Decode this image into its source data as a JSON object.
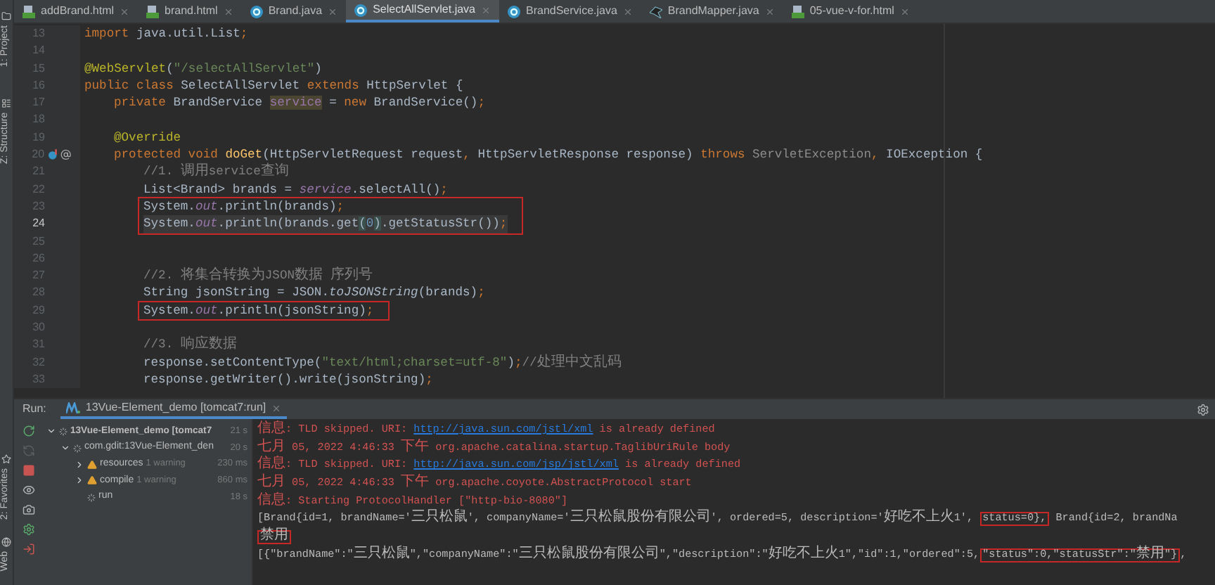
{
  "tool_strip": {
    "top": [
      {
        "label": "1: Project",
        "kind": "project"
      },
      {
        "label": "Z: Structure",
        "kind": "structure"
      }
    ],
    "bottom": [
      {
        "label": "2: Favorites",
        "kind": "favorites"
      },
      {
        "label": "Web",
        "kind": "web"
      }
    ]
  },
  "tabs": [
    {
      "label": "addBrand.html",
      "kind": "html",
      "selected": false
    },
    {
      "label": "brand.html",
      "kind": "html",
      "selected": false
    },
    {
      "label": "Brand.java",
      "kind": "class",
      "selected": false
    },
    {
      "label": "SelectAllServlet.java",
      "kind": "class",
      "selected": true
    },
    {
      "label": "BrandService.java",
      "kind": "class",
      "selected": false
    },
    {
      "label": "BrandMapper.java",
      "kind": "mapper",
      "selected": false
    },
    {
      "label": "05-vue-v-for.html",
      "kind": "html",
      "selected": false
    }
  ],
  "editor": {
    "lines": [
      {
        "kind": "line",
        "number": "13",
        "current": false,
        "tokens": [
          {
            "kind": "kw",
            "t": "import"
          },
          {
            "kind": "plain",
            "t": " java.util.List"
          },
          {
            "kind": "kw",
            "t": ";"
          }
        ]
      },
      {
        "kind": "line",
        "number": "14",
        "current": false
      },
      {
        "kind": "line",
        "number": "15",
        "current": false,
        "tokens": [
          {
            "kind": "ann",
            "t": "@WebServlet"
          },
          {
            "kind": "plain",
            "t": "("
          },
          {
            "kind": "str",
            "t": "\"/selectAllServlet\""
          },
          {
            "kind": "plain",
            "t": ")"
          }
        ]
      },
      {
        "kind": "line",
        "number": "16",
        "current": false,
        "tokens": [
          {
            "kind": "kw",
            "t": "public class"
          },
          {
            "kind": "plain",
            "t": " SelectAllServlet "
          },
          {
            "kind": "kw",
            "t": "extends"
          },
          {
            "kind": "plain",
            "t": " HttpServlet {"
          }
        ],
        "children": [
          {
            "kind": "line",
            "number": "17",
            "current": false,
            "tokens": [
              {
                "kind": "kw",
                "t": "private"
              },
              {
                "kind": "plain",
                "t": " BrandService "
              },
              {
                "kind": "usage",
                "t": "service"
              },
              {
                "kind": "plain",
                "t": " = "
              },
              {
                "kind": "kw",
                "t": "new"
              },
              {
                "kind": "plain",
                "t": " BrandService()"
              },
              {
                "kind": "kw",
                "t": ";"
              }
            ]
          },
          {
            "kind": "line",
            "number": "18",
            "current": false
          },
          {
            "kind": "line",
            "number": "19",
            "current": false,
            "tokens": [
              {
                "kind": "ann",
                "t": "@Override"
              }
            ]
          },
          {
            "kind": "line",
            "number": "20",
            "current": false,
            "gutter_icons": [
              {
                "kind": "overrides"
              },
              {
                "kind": "annotated"
              }
            ],
            "tokens": [
              {
                "kind": "kw",
                "t": "protected void "
              },
              {
                "kind": "fn",
                "t": "doGet"
              },
              {
                "kind": "plain",
                "t": "(HttpServletRequest request"
              },
              {
                "kind": "kw",
                "t": ","
              },
              {
                "kind": "plain",
                "t": " HttpServletResponse response) "
              },
              {
                "kind": "kw",
                "t": "throws "
              },
              {
                "kind": "muted",
                "t": "ServletException"
              },
              {
                "kind": "kw",
                "t": ","
              },
              {
                "kind": "plain",
                "t": " IOException {"
              }
            ],
            "children": [
              {
                "kind": "line",
                "number": "21",
                "current": false,
                "tokens": [
                  {
                    "kind": "cmt",
                    "t": "//1. 调用service查询"
                  }
                ]
              },
              {
                "kind": "line",
                "number": "22",
                "current": false,
                "tokens": [
                  {
                    "kind": "plain",
                    "t": "List<Brand> brands = "
                  },
                  {
                    "kind": "field",
                    "t": "service"
                  },
                  {
                    "kind": "plain",
                    "t": ".selectAll()"
                  },
                  {
                    "kind": "kw",
                    "t": ";"
                  }
                ]
              },
              {
                "kind": "box",
                "lines": [
                  {
                    "kind": "line",
                    "number": "23",
                    "current": false,
                    "tokens": [
                      {
                        "kind": "plain",
                        "t": "System."
                      },
                      {
                        "kind": "field",
                        "t": "out"
                      },
                      {
                        "kind": "plain",
                        "t": ".println(brands)"
                      },
                      {
                        "kind": "kw",
                        "t": ";"
                      }
                    ]
                  },
                  {
                    "kind": "line",
                    "number": "24",
                    "current": true,
                    "tokens": [
                      {
                        "kind": "plain",
                        "t": "System."
                      },
                      {
                        "kind": "field",
                        "t": "out"
                      },
                      {
                        "kind": "plain",
                        "t": ".println(brands.get"
                      },
                      {
                        "kind": "match",
                        "t": "("
                      },
                      {
                        "kind": "num",
                        "t": "0"
                      },
                      {
                        "kind": "match",
                        "t": ")"
                      },
                      {
                        "kind": "plain",
                        "t": ".getStatusStr())"
                      },
                      {
                        "kind": "kw",
                        "t": ";"
                      }
                    ]
                  }
                ]
              },
              {
                "kind": "line",
                "number": "25",
                "current": false
              },
              {
                "kind": "line",
                "number": "26",
                "current": false
              },
              {
                "kind": "line",
                "number": "27",
                "current": false,
                "tokens": [
                  {
                    "kind": "cmt",
                    "t": "//2. 将集合转换为JSON数据 序列号"
                  }
                ]
              },
              {
                "kind": "line",
                "number": "28",
                "current": false,
                "tokens": [
                  {
                    "kind": "plain",
                    "t": "String jsonString = JSON."
                  },
                  {
                    "kind": "static",
                    "t": "toJSONString"
                  },
                  {
                    "kind": "plain",
                    "t": "(brands)"
                  },
                  {
                    "kind": "kw",
                    "t": ";"
                  }
                ]
              },
              {
                "kind": "box",
                "lines": [
                  {
                    "kind": "line",
                    "number": "29",
                    "current": false,
                    "tokens": [
                      {
                        "kind": "plain",
                        "t": "System."
                      },
                      {
                        "kind": "field",
                        "t": "out"
                      },
                      {
                        "kind": "plain",
                        "t": ".println(jsonString)"
                      },
                      {
                        "kind": "kw",
                        "t": ";"
                      }
                    ]
                  }
                ]
              },
              {
                "kind": "line",
                "number": "30",
                "current": false
              },
              {
                "kind": "line",
                "number": "31",
                "current": false,
                "tokens": [
                  {
                    "kind": "cmt",
                    "t": "//3. 响应数据"
                  }
                ]
              },
              {
                "kind": "line",
                "number": "32",
                "current": false,
                "tokens": [
                  {
                    "kind": "plain",
                    "t": "response.setContentType("
                  },
                  {
                    "kind": "str",
                    "t": "\"text/html;charset=utf-8\""
                  },
                  {
                    "kind": "plain",
                    "t": ")"
                  },
                  {
                    "kind": "kw",
                    "t": ";"
                  },
                  {
                    "kind": "cmt",
                    "t": "//处理中文乱码"
                  }
                ]
              },
              {
                "kind": "line",
                "number": "33",
                "current": false,
                "tokens": [
                  {
                    "kind": "plain",
                    "t": "response.getWriter().write(jsonString)"
                  },
                  {
                    "kind": "kw",
                    "t": ";"
                  }
                ]
              }
            ]
          }
        ]
      }
    ]
  },
  "run": {
    "label": "Run:",
    "tab": "13Vue-Element_demo [tomcat7:run]",
    "toolbar": [
      {
        "kind": "rerun",
        "disabled": false
      },
      {
        "kind": "rerun_failed",
        "disabled": true
      },
      {
        "kind": "stop",
        "disabled": false
      },
      {
        "kind": "view",
        "disabled": false
      },
      {
        "kind": "snapshot",
        "disabled": false
      },
      {
        "kind": "settings",
        "disabled": false
      },
      {
        "kind": "exit",
        "disabled": false
      }
    ],
    "tree": [
      {
        "label": "13Vue-Element_demo [tomcat7",
        "time": "21 s",
        "kind": "running",
        "expandable": true,
        "expanded": true,
        "children": [
          {
            "label": "com.gdit:13Vue-Element_den",
            "time": "20 s",
            "kind": "running",
            "expandable": true,
            "expanded": true,
            "children": [
              {
                "label": "resources",
                "note": "1 warning",
                "time": "230 ms",
                "kind": "warning",
                "expandable": true,
                "expanded": false
              },
              {
                "label": "compile",
                "note": "1 warning",
                "time": "860 ms",
                "kind": "warning",
                "expandable": true,
                "expanded": false
              },
              {
                "label": "run",
                "time": "18 s",
                "kind": "running",
                "expandable": false,
                "expanded": false
              }
            ]
          }
        ]
      }
    ],
    "console": [
      {
        "kind": "info",
        "tokens": [
          {
            "kind": "text",
            "text": "信息: TLD skipped. URI: ",
            "boxed": false
          },
          {
            "kind": "link",
            "text": "http://java.sun.com/jstl/xml",
            "boxed": false
          },
          {
            "kind": "text",
            "text": " is already defined",
            "boxed": false
          }
        ]
      },
      {
        "kind": "info",
        "tokens": [
          {
            "kind": "text",
            "text": "七月 05, 2022 4:46:33 下午 org.apache.catalina.startup.TaglibUriRule body",
            "boxed": false
          }
        ]
      },
      {
        "kind": "info",
        "tokens": [
          {
            "kind": "text",
            "text": "信息: TLD skipped. URI: ",
            "boxed": false
          },
          {
            "kind": "link",
            "text": "http://java.sun.com/jsp/jstl/xml",
            "boxed": false
          },
          {
            "kind": "text",
            "text": " is already defined",
            "boxed": false
          }
        ]
      },
      {
        "kind": "info",
        "tokens": [
          {
            "kind": "text",
            "text": "七月 05, 2022 4:46:33 下午 org.apache.coyote.AbstractProtocol start",
            "boxed": false
          }
        ]
      },
      {
        "kind": "info",
        "tokens": [
          {
            "kind": "text",
            "text": "信息: Starting ProtocolHandler [\"http-bio-8080\"]",
            "boxed": false
          }
        ]
      },
      {
        "kind": "output",
        "tokens": [
          {
            "kind": "text",
            "text": "[Brand{id=1, brandName='三只松鼠', companyName='三只松鼠股份有限公司', ordered=5, description='好吃不上火1', ",
            "boxed": false
          },
          {
            "kind": "text",
            "text": "status=0},",
            "boxed": true
          },
          {
            "kind": "text",
            "text": " Brand{id=2, brandNa",
            "boxed": false
          }
        ]
      },
      {
        "kind": "output",
        "tokens": [
          {
            "kind": "text",
            "text": "禁用",
            "boxed": true
          }
        ]
      },
      {
        "kind": "output",
        "tokens": [
          {
            "kind": "text",
            "text": "[{\"brandName\":\"三只松鼠\",\"companyName\":\"三只松鼠股份有限公司\",\"description\":\"好吃不上火1\",\"id\":1,\"ordered\":5,",
            "boxed": false
          },
          {
            "kind": "text",
            "text": "\"status\":0,\"statusStr\":\"禁用\"}",
            "boxed": true
          },
          {
            "kind": "text",
            "text": ",",
            "boxed": false
          }
        ]
      }
    ]
  }
}
